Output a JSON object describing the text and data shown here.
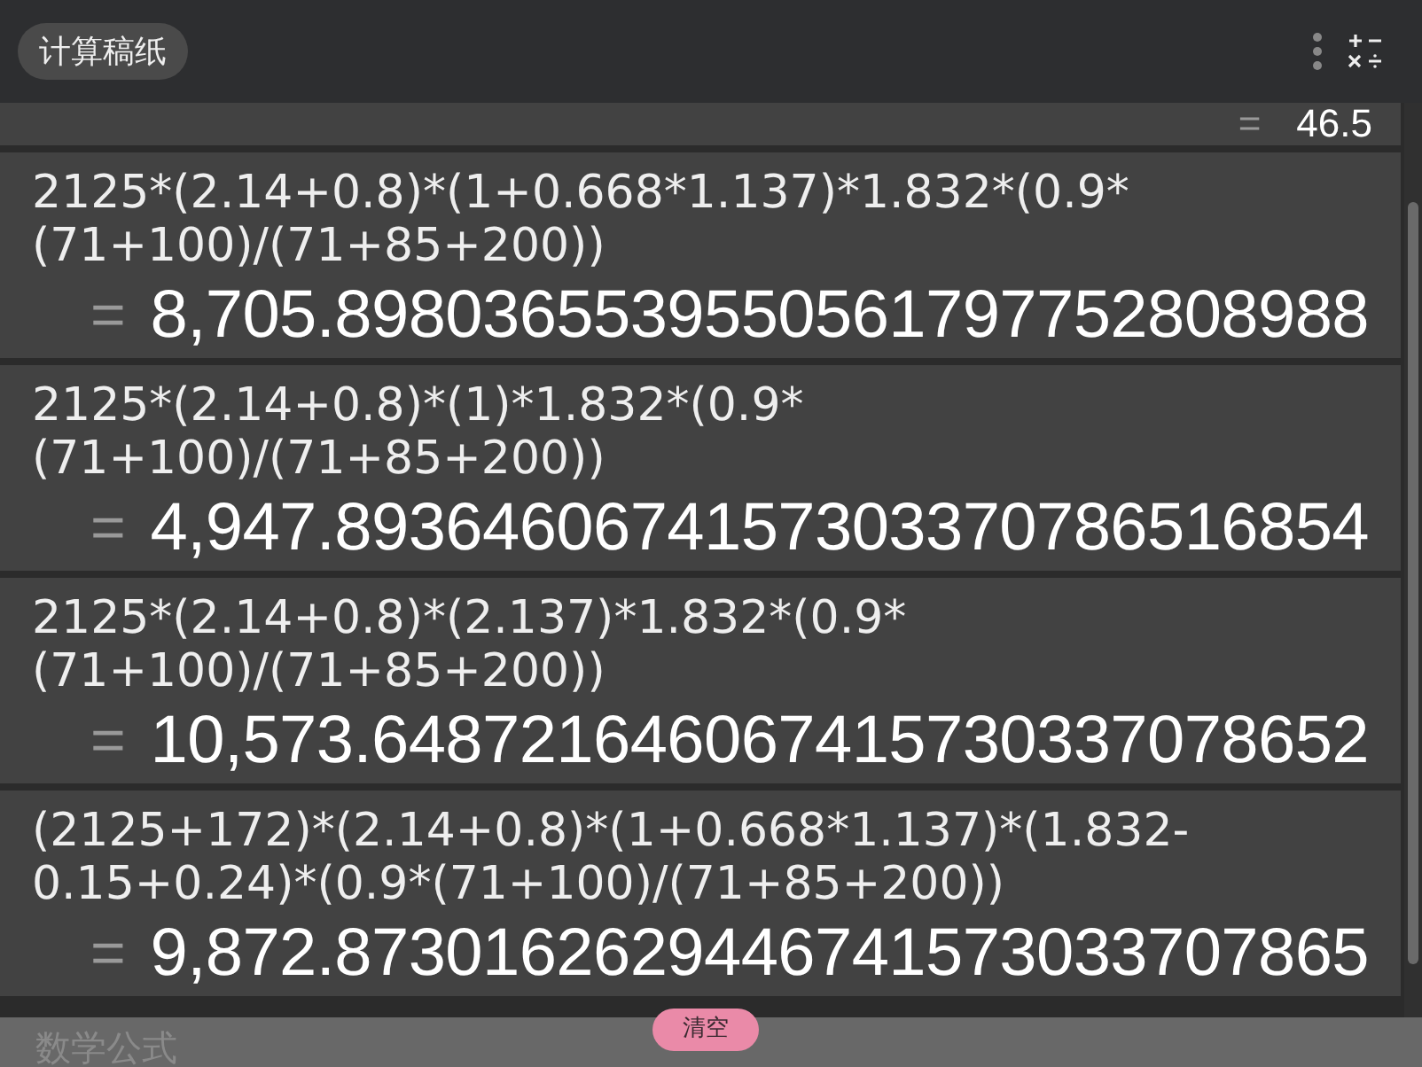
{
  "header": {
    "title": "计算稿纸"
  },
  "entries": [
    {
      "kind": "result_only",
      "result": "46.5"
    },
    {
      "expression_lines": [
        "2125*(2.14+0.8)*(1+0.668*1.137)*1.832*(0.9*",
        "(71+100)/(71+85+200))"
      ],
      "kind": "full",
      "result": "8,705.8980365539550561797752808988"
    },
    {
      "expression_lines": [
        "2125*(2.14+0.8)*(1)*1.832*(0.9*",
        "(71+100)/(71+85+200))"
      ],
      "kind": "full",
      "result": "4,947.8936460674157303370786516854"
    },
    {
      "expression_lines": [
        "2125*(2.14+0.8)*(2.137)*1.832*(0.9*",
        "(71+100)/(71+85+200))"
      ],
      "kind": "full",
      "result": "10,573.648721646067415730337078652"
    },
    {
      "expression_lines": [
        "(2125+172)*(2.14+0.8)*(1+0.668*1.137)*(1.832-",
        "0.15+0.24)*(0.9*(71+100)/(71+85+200))"
      ],
      "kind": "full",
      "result": "9,872.8730162629446741573033707865"
    }
  ],
  "equals_sign": "=",
  "clear_button": "清空",
  "background_text": "数学公式"
}
